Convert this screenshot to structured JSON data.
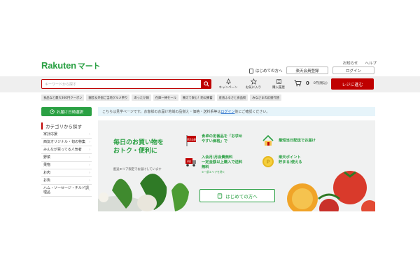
{
  "header": {
    "logo_main": "Rakuten",
    "logo_sub": "マート",
    "help_links": [
      "お知らせ",
      "ヘルプ"
    ],
    "guide_link": "はじめての方へ",
    "register_button": "楽天会員登録",
    "login_button": "ログイン"
  },
  "searchbar": {
    "placeholder": "キーワードから探す",
    "icons": [
      {
        "label": "キャンペーン",
        "icon": "campaign-icon"
      },
      {
        "label": "お気に入り",
        "icon": "star-icon"
      },
      {
        "label": "購入履歴",
        "icon": "history-icon"
      }
    ],
    "cart_count": "0",
    "cart_total": "0円(税込)",
    "checkout_button": "レジに進む"
  },
  "chips": [
    "食品など最大360円クーポン",
    "園芸＆外国ご当地グルメ祭り",
    "あったか鍋",
    "在庫一掃セール",
    "備えて安心！防災備蓄",
    "産直ふるさと食品街",
    "みなさまの応援代替"
  ],
  "delivery_button": "お届け日時選択",
  "info_bar": {
    "text_before": "こちらは見学ページです。お客様のお届け地域の品揃え・価格・送料系等は",
    "link": "ログイン",
    "text_after": "後にご確認ください。"
  },
  "sidebar": {
    "title": "カテゴリから探す",
    "items": [
      "家計応援",
      "西友オリジナル・旬の特集",
      "みんなが買ってる人気者",
      "野菜",
      "果物",
      "お肉",
      "お魚",
      "ハム・ソーセージ・チルド調理品"
    ]
  },
  "hero": {
    "title_line1": "毎日のお買い物を",
    "title_line2": "おトク・便利に",
    "note": "配送エリア限定でお届けしています",
    "features": [
      {
        "icon": "price-flag-icon",
        "badge": "家計応援",
        "line1": "食卓の定番品を「お求め",
        "line2": "やすい価格」で",
        "sub": ""
      },
      {
        "icon": "house-icon",
        "badge": "",
        "line1": "最短当日配送でお届け",
        "line2": "",
        "sub": ""
      },
      {
        "icon": "truck-icon",
        "badge": "",
        "line1": "入会月/月会費無料",
        "line2": "一定金額以上購入で送料",
        "line3": "無料",
        "sub": "※一部エリアを除く"
      },
      {
        "icon": "points-icon",
        "badge": "",
        "line1": "楽天ポイント",
        "line2": "貯まる/使える",
        "sub": ""
      }
    ],
    "first_time_button": "はじめての方へ"
  },
  "colors": {
    "brand_green": "#2aa043",
    "brand_red": "#bf0000",
    "info_bg": "#e6f4fa"
  }
}
